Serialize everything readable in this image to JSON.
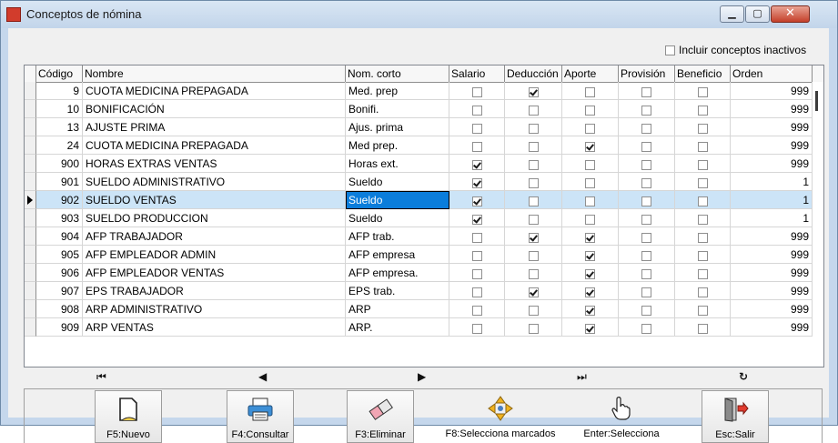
{
  "window": {
    "title": "Conceptos de nómina"
  },
  "filter": {
    "include_inactive_label": "Incluir conceptos inactivos",
    "include_inactive": false
  },
  "columns": [
    "Código",
    "Nombre",
    "Nom. corto",
    "Salario",
    "Deducción",
    "Aporte",
    "Provisión",
    "Beneficio",
    "Orden"
  ],
  "rows": [
    {
      "codigo": "9",
      "nombre": "CUOTA MEDICINA PREPAGADA",
      "corto": "Med. prep",
      "salario": false,
      "deduccion": true,
      "aporte": false,
      "provision": false,
      "beneficio": false,
      "orden": "999"
    },
    {
      "codigo": "10",
      "nombre": "BONIFICACIÓN",
      "corto": "Bonifi.",
      "salario": false,
      "deduccion": false,
      "aporte": false,
      "provision": false,
      "beneficio": false,
      "orden": "999"
    },
    {
      "codigo": "13",
      "nombre": "AJUSTE PRIMA",
      "corto": "Ajus. prima",
      "salario": false,
      "deduccion": false,
      "aporte": false,
      "provision": false,
      "beneficio": false,
      "orden": "999"
    },
    {
      "codigo": "24",
      "nombre": "CUOTA MEDICINA PREPAGADA",
      "corto": "Med prep.",
      "salario": false,
      "deduccion": false,
      "aporte": true,
      "provision": false,
      "beneficio": false,
      "orden": "999"
    },
    {
      "codigo": "900",
      "nombre": "HORAS EXTRAS VENTAS",
      "corto": "Horas ext.",
      "salario": true,
      "deduccion": false,
      "aporte": false,
      "provision": false,
      "beneficio": false,
      "orden": "999"
    },
    {
      "codigo": "901",
      "nombre": "SUELDO ADMINISTRATIVO",
      "corto": "Sueldo",
      "salario": true,
      "deduccion": false,
      "aporte": false,
      "provision": false,
      "beneficio": false,
      "orden": "1"
    },
    {
      "codigo": "902",
      "nombre": "SUELDO VENTAS",
      "corto": "Sueldo",
      "salario": true,
      "deduccion": false,
      "aporte": false,
      "provision": false,
      "beneficio": false,
      "orden": "1",
      "selected": true
    },
    {
      "codigo": "903",
      "nombre": "SUELDO PRODUCCION",
      "corto": "Sueldo",
      "salario": true,
      "deduccion": false,
      "aporte": false,
      "provision": false,
      "beneficio": false,
      "orden": "1"
    },
    {
      "codigo": "904",
      "nombre": "AFP TRABAJADOR",
      "corto": "AFP trab.",
      "salario": false,
      "deduccion": true,
      "aporte": true,
      "provision": false,
      "beneficio": false,
      "orden": "999"
    },
    {
      "codigo": "905",
      "nombre": "AFP EMPLEADOR ADMIN",
      "corto": "AFP empresa",
      "salario": false,
      "deduccion": false,
      "aporte": true,
      "provision": false,
      "beneficio": false,
      "orden": "999"
    },
    {
      "codigo": "906",
      "nombre": "AFP EMPLEADOR VENTAS",
      "corto": "AFP empresa.",
      "salario": false,
      "deduccion": false,
      "aporte": true,
      "provision": false,
      "beneficio": false,
      "orden": "999"
    },
    {
      "codigo": "907",
      "nombre": "EPS TRABAJADOR",
      "corto": "EPS trab.",
      "salario": false,
      "deduccion": true,
      "aporte": true,
      "provision": false,
      "beneficio": false,
      "orden": "999"
    },
    {
      "codigo": "908",
      "nombre": "ARP ADMINISTRATIVO",
      "corto": "ARP",
      "salario": false,
      "deduccion": false,
      "aporte": true,
      "provision": false,
      "beneficio": false,
      "orden": "999"
    },
    {
      "codigo": "909",
      "nombre": "ARP VENTAS",
      "corto": "ARP.",
      "salario": false,
      "deduccion": false,
      "aporte": true,
      "provision": false,
      "beneficio": false,
      "orden": "999"
    }
  ],
  "toolbar": {
    "nuevo": "F5:Nuevo",
    "consultar": "F4:Consultar",
    "eliminar": "F3:Eliminar",
    "marcados": "F8:Selecciona marcados",
    "selecciona": "Enter:Selecciona",
    "salir": "Esc:Salir"
  },
  "icons": {
    "nuevo": "document-icon",
    "consultar": "printer-icon",
    "eliminar": "eraser-icon",
    "marcados": "arrows-icon",
    "selecciona": "hand-pointer-icon",
    "salir": "exit-door-icon"
  }
}
